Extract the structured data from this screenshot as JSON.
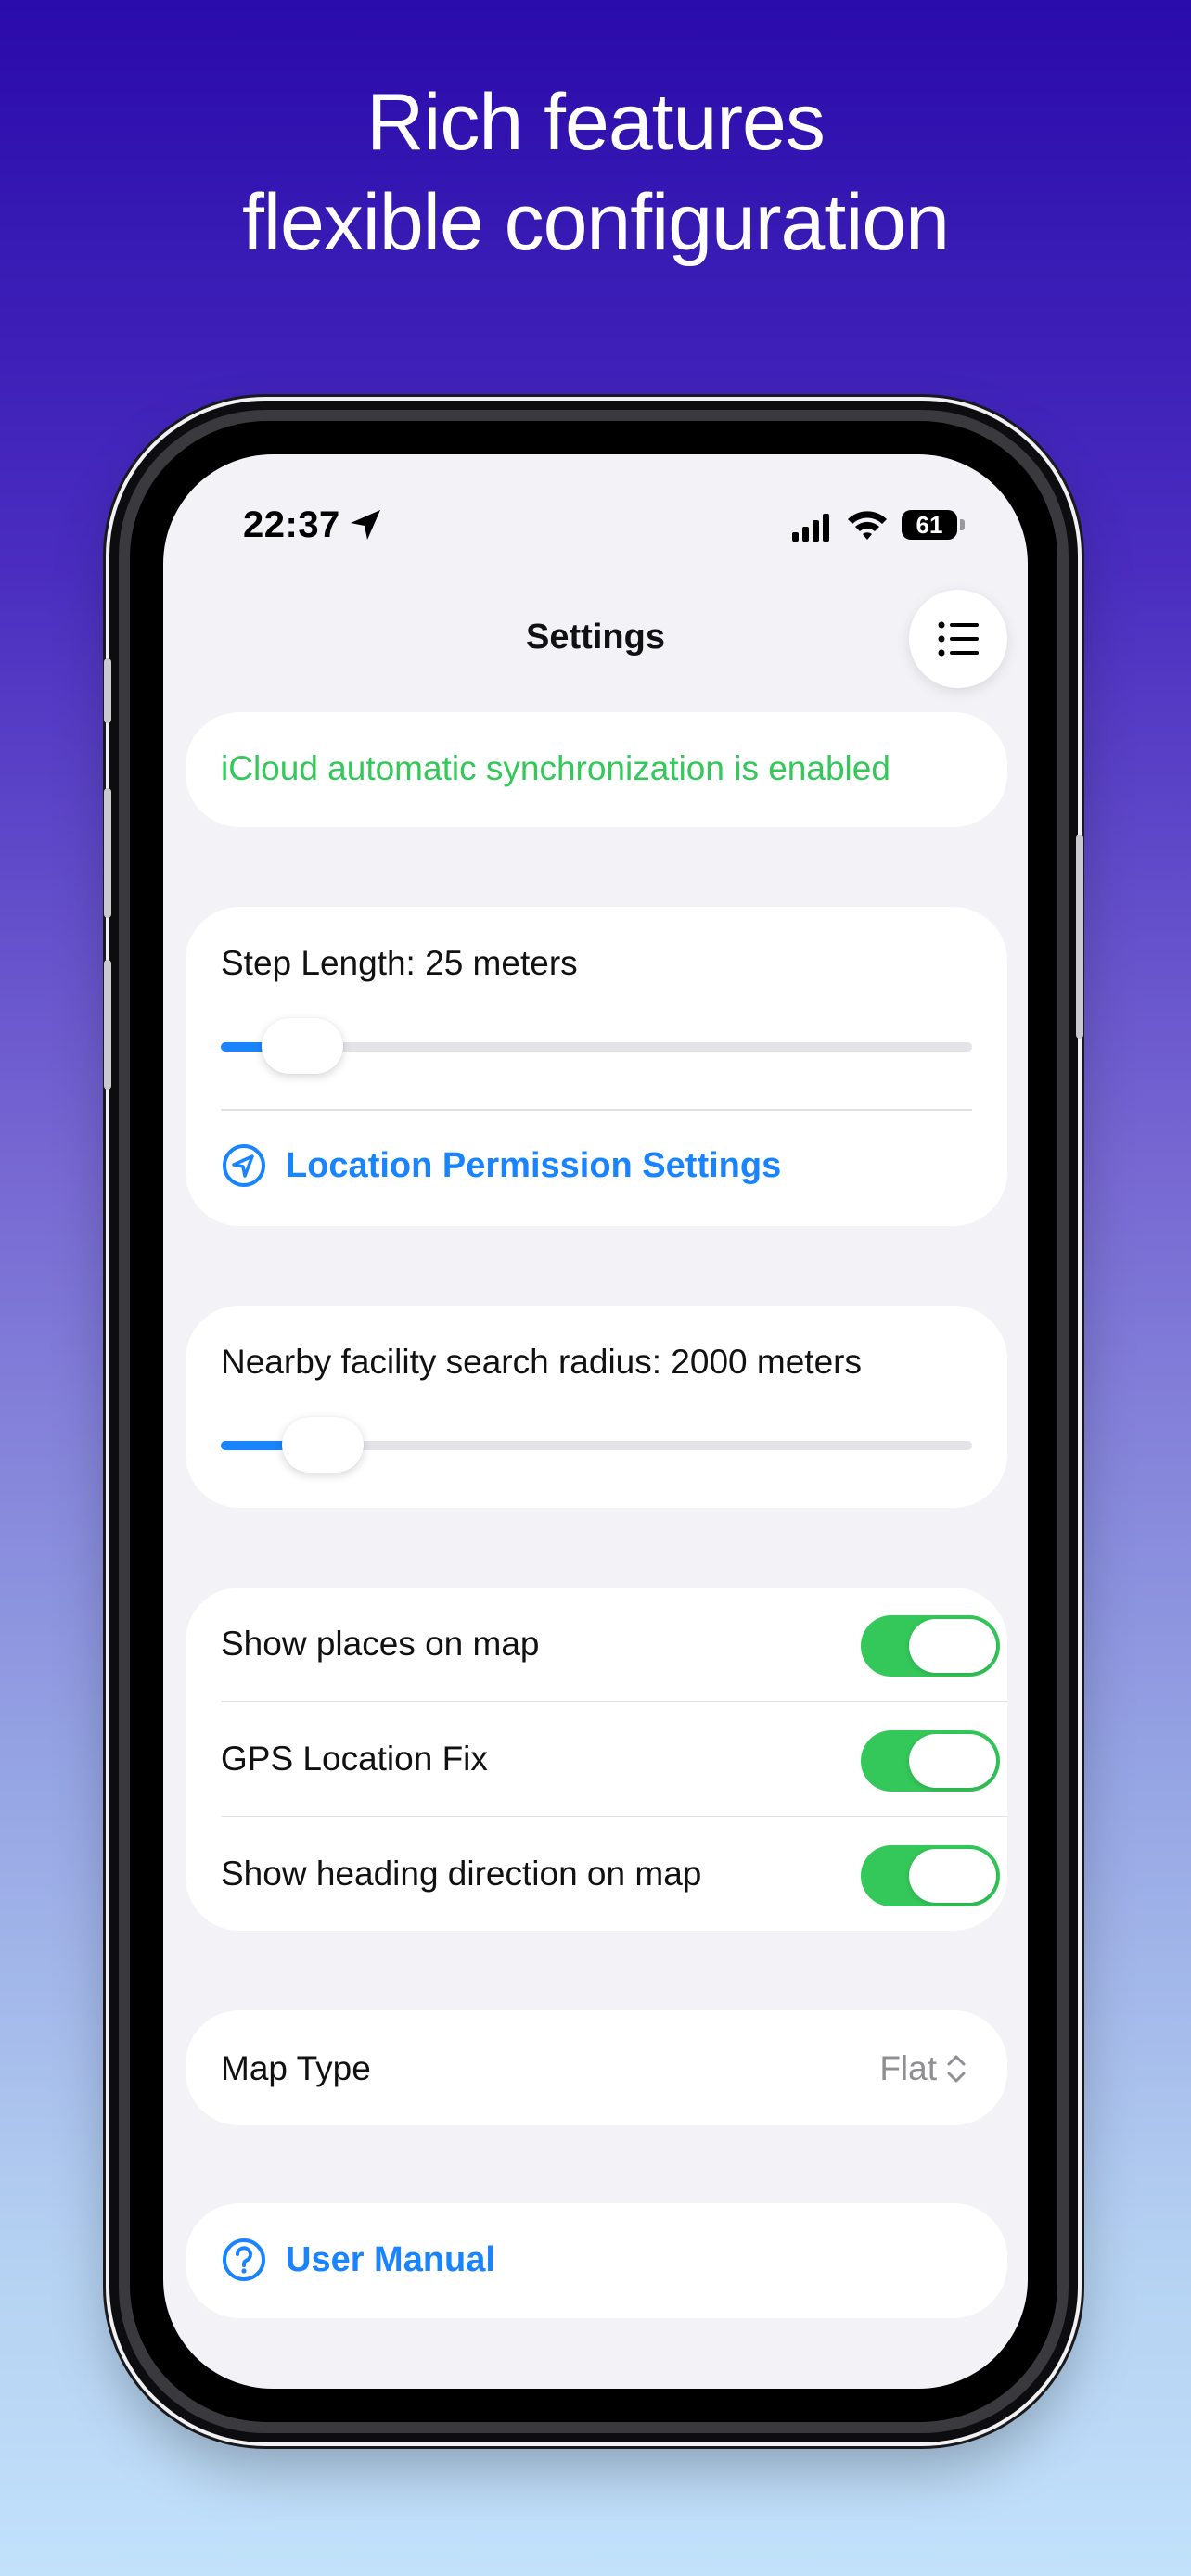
{
  "headline": {
    "line1": "Rich features",
    "line2": "flexible configuration"
  },
  "status_bar": {
    "time": "22:37",
    "battery": "61",
    "icons": [
      "location-arrow-icon",
      "cellular-signal-icon",
      "wifi-icon",
      "battery-icon"
    ]
  },
  "nav": {
    "title": "Settings",
    "menu_icon": "list-icon"
  },
  "sync": {
    "message": "iCloud automatic synchronization is enabled"
  },
  "step_length": {
    "label": "Step Length: 25 meters",
    "slider_fraction": 0.07
  },
  "location_permission": {
    "label": "Location Permission Settings",
    "icon": "location-arrow-circle-icon"
  },
  "search_radius": {
    "label": "Nearby facility search radius: 2000 meters",
    "slider_fraction": 0.1
  },
  "toggles": [
    {
      "label": "Show places on map",
      "on": true
    },
    {
      "label": "GPS Location Fix",
      "on": true
    },
    {
      "label": "Show heading direction on map",
      "on": true
    }
  ],
  "map_type": {
    "label": "Map Type",
    "value": "Flat",
    "icon": "chevron-up-down-icon"
  },
  "manual": {
    "label": "User Manual",
    "icon": "question-circle-icon"
  },
  "colors": {
    "accent_blue": "#1a84ff",
    "sync_green": "#34c759",
    "toggle_green": "#34c759",
    "screen_bg": "#f2f2f7"
  }
}
